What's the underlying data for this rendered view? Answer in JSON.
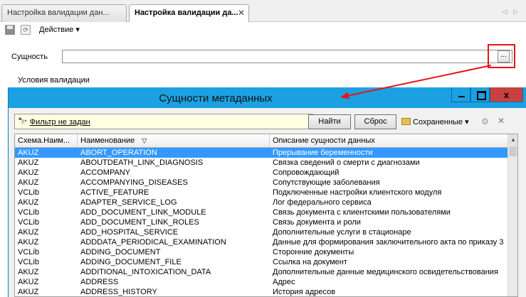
{
  "tabs": [
    {
      "label": "Настройка валидации дан..."
    },
    {
      "label": "Настройка валидации да...",
      "close": "✕"
    }
  ],
  "tabnav": "◁ ▷",
  "toolbar": {
    "action_label": "Действие ▾"
  },
  "form": {
    "entity_label": "Сущность",
    "entity_value": "",
    "pick_label": "...",
    "validation_label": "Условия валидации"
  },
  "dialog": {
    "title": "Сущности метаданных",
    "close_glyph": "x",
    "filter_link": "Фильтр не задан",
    "find_button": "Найти",
    "reset_button": "Сброс",
    "saved_label": "Сохраненные ▾",
    "clear_glyph": "✕"
  },
  "grid": {
    "columns": [
      "Схема.Наим...",
      "Наименование",
      "Описание сущности данных"
    ],
    "rows": [
      [
        "AKUZ",
        "ABORT_OPERATION",
        "Прерывание беременности"
      ],
      [
        "AKUZ",
        "ABOUTDEATH_LINK_DIAGNOSIS",
        "Связка сведений о смерти с диагнозами"
      ],
      [
        "AKUZ",
        "ACCOMPANY",
        "Сопровождающий"
      ],
      [
        "AKUZ",
        "ACCOMPANYING_DISEASES",
        "Сопутствующие заболевания"
      ],
      [
        "VCLib",
        "ACTIVE_FEATURE",
        "Подключенные настройки клиентского модуля"
      ],
      [
        "AKUZ",
        "ADAPTER_SERVICE_LOG",
        "Лог федерального сервиса"
      ],
      [
        "VCLib",
        "ADD_DOCUMENT_LINK_MODULE",
        "Связь документа с клиентскими пользователями"
      ],
      [
        "VCLib",
        "ADD_DOCUMENT_LINK_ROLES",
        "Связь документа и роли"
      ],
      [
        "AKUZ",
        "ADD_HOSPITAL_SERVICE",
        "Дополнительные услуги в стационаре"
      ],
      [
        "AKUZ",
        "ADDDATA_PERIODICAL_EXAMINATION",
        "Данные для формирования заключительного акта по приказу 3"
      ],
      [
        "VCLib",
        "ADDING_DOCUMENT",
        "Сторонние документы"
      ],
      [
        "VCLib",
        "ADDING_DOCUMENT_FILE",
        "Ссылка на документ"
      ],
      [
        "AKUZ",
        "ADDITIONAL_INTOXICATION_DATA",
        "Дополнительные данные медицинского освидетельствования"
      ],
      [
        "AKUZ",
        "ADDRESS",
        "Адрес"
      ],
      [
        "AKUZ",
        "ADDRESS_HISTORY",
        "История адресов"
      ]
    ]
  },
  "colors": {
    "titlebar": "#1ba1e2",
    "selection": "#3399ff",
    "highlight": "#e8141a",
    "close": "#c7413f"
  }
}
